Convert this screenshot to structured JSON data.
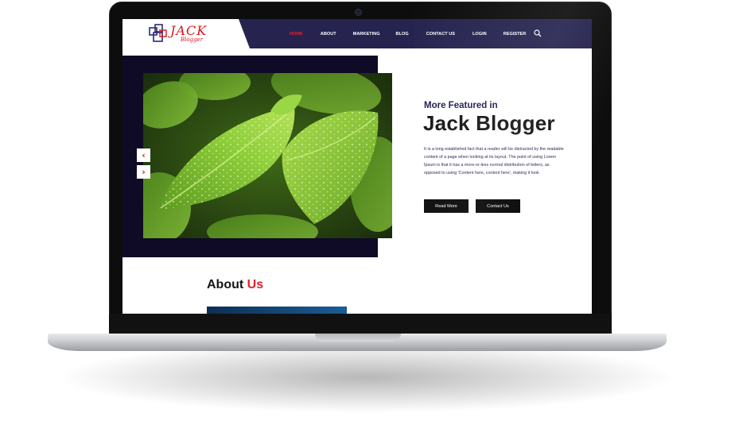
{
  "brand": {
    "name": "JACK",
    "tagline": "Blogger"
  },
  "nav": {
    "items": [
      {
        "label": "HOME",
        "active": true
      },
      {
        "label": "ABOUT",
        "active": false
      },
      {
        "label": "MARKETING",
        "active": false
      },
      {
        "label": "BLOG",
        "active": false
      },
      {
        "label": "CONTACT US",
        "active": false
      },
      {
        "label": "LOGIN",
        "active": false
      },
      {
        "label": "REGISTER",
        "active": false
      }
    ],
    "search_icon": "search-icon"
  },
  "hero": {
    "pretitle": "More Featured in",
    "title": "Jack Blogger",
    "text": "It is a long established fact that a reader will be distracted by the readable content of a page when looking at its layout. The point of using Lorem Ipsum is that it has a more-or-less normal distribution of letters, as opposed to using 'Content here, content here', making it look",
    "prev_icon": "‹",
    "next_icon": "›",
    "read_more": "Read More",
    "contact": "Contact Us"
  },
  "about": {
    "title_main": "About",
    "title_highlight": "Us"
  },
  "colors": {
    "accent": "#e3202a",
    "nav_bg": "#26244f",
    "hero_dark": "#0f0b27",
    "leaf": "#7cc23a"
  }
}
